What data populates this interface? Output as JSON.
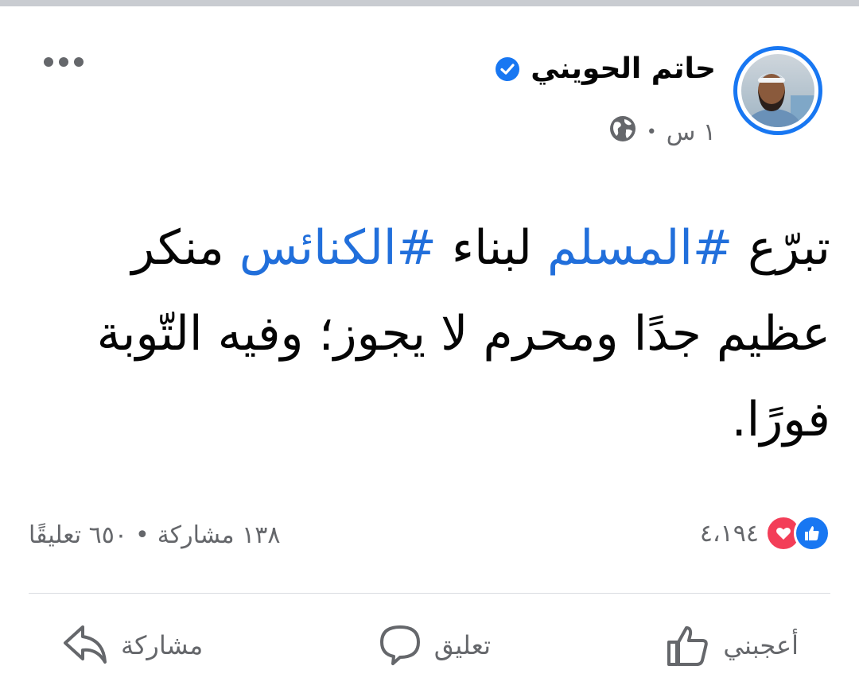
{
  "post": {
    "author_name": "حاتم الحويني",
    "time": "١ س",
    "meta_separator": "•",
    "text_segments": [
      {
        "text": "تبرّع ",
        "hashtag": false
      },
      {
        "text": "#المسلم",
        "hashtag": true
      },
      {
        "text": " لبناء ",
        "hashtag": false
      },
      {
        "text": "#الكنائس",
        "hashtag": true
      },
      {
        "text": " منكر عظيم جدًا ومحرم لا يجوز؛ وفيه التّوبة فورًا.",
        "hashtag": false
      }
    ]
  },
  "stats": {
    "reactions_count": "٤،١٩٤",
    "comments": "٦٥٠ تعليقًا",
    "separator": "•",
    "shares": "١٣٨ مشاركة"
  },
  "actions": {
    "like_label": "أعجبني",
    "comment_label": "تعليق",
    "share_label": "مشاركة"
  },
  "icons": {
    "more": "more-options-icon",
    "verified": "verified-badge-icon",
    "audience": "globe-icon",
    "reaction_like": "like-reaction-icon",
    "reaction_love": "love-reaction-icon",
    "like": "thumbs-up-icon",
    "comment": "comment-bubble-icon",
    "share": "share-arrow-icon"
  },
  "colors": {
    "accent": "#1877f2",
    "hashtag": "#216fdb",
    "love": "#f33e58",
    "secondary_text": "#65676b",
    "primary_text": "#050505"
  }
}
